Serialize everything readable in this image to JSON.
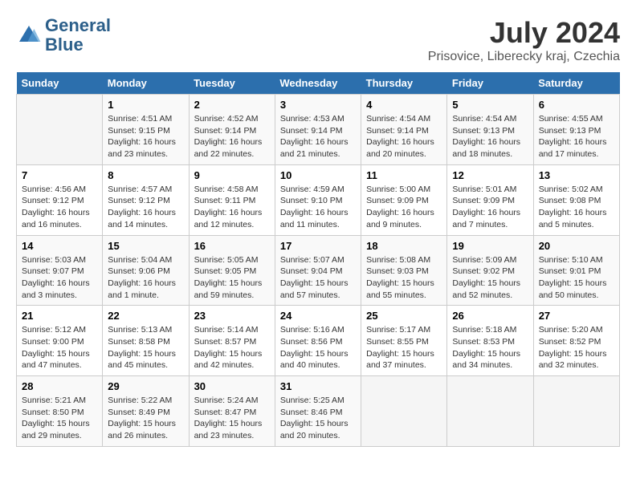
{
  "header": {
    "logo_line1": "General",
    "logo_line2": "Blue",
    "title": "July 2024",
    "subtitle": "Prisovice, Liberecky kraj, Czechia"
  },
  "calendar": {
    "headers": [
      "Sunday",
      "Monday",
      "Tuesday",
      "Wednesday",
      "Thursday",
      "Friday",
      "Saturday"
    ],
    "weeks": [
      [
        {
          "day": "",
          "info": ""
        },
        {
          "day": "1",
          "info": "Sunrise: 4:51 AM\nSunset: 9:15 PM\nDaylight: 16 hours\nand 23 minutes."
        },
        {
          "day": "2",
          "info": "Sunrise: 4:52 AM\nSunset: 9:14 PM\nDaylight: 16 hours\nand 22 minutes."
        },
        {
          "day": "3",
          "info": "Sunrise: 4:53 AM\nSunset: 9:14 PM\nDaylight: 16 hours\nand 21 minutes."
        },
        {
          "day": "4",
          "info": "Sunrise: 4:54 AM\nSunset: 9:14 PM\nDaylight: 16 hours\nand 20 minutes."
        },
        {
          "day": "5",
          "info": "Sunrise: 4:54 AM\nSunset: 9:13 PM\nDaylight: 16 hours\nand 18 minutes."
        },
        {
          "day": "6",
          "info": "Sunrise: 4:55 AM\nSunset: 9:13 PM\nDaylight: 16 hours\nand 17 minutes."
        }
      ],
      [
        {
          "day": "7",
          "info": "Sunrise: 4:56 AM\nSunset: 9:12 PM\nDaylight: 16 hours\nand 16 minutes."
        },
        {
          "day": "8",
          "info": "Sunrise: 4:57 AM\nSunset: 9:12 PM\nDaylight: 16 hours\nand 14 minutes."
        },
        {
          "day": "9",
          "info": "Sunrise: 4:58 AM\nSunset: 9:11 PM\nDaylight: 16 hours\nand 12 minutes."
        },
        {
          "day": "10",
          "info": "Sunrise: 4:59 AM\nSunset: 9:10 PM\nDaylight: 16 hours\nand 11 minutes."
        },
        {
          "day": "11",
          "info": "Sunrise: 5:00 AM\nSunset: 9:09 PM\nDaylight: 16 hours\nand 9 minutes."
        },
        {
          "day": "12",
          "info": "Sunrise: 5:01 AM\nSunset: 9:09 PM\nDaylight: 16 hours\nand 7 minutes."
        },
        {
          "day": "13",
          "info": "Sunrise: 5:02 AM\nSunset: 9:08 PM\nDaylight: 16 hours\nand 5 minutes."
        }
      ],
      [
        {
          "day": "14",
          "info": "Sunrise: 5:03 AM\nSunset: 9:07 PM\nDaylight: 16 hours\nand 3 minutes."
        },
        {
          "day": "15",
          "info": "Sunrise: 5:04 AM\nSunset: 9:06 PM\nDaylight: 16 hours\nand 1 minute."
        },
        {
          "day": "16",
          "info": "Sunrise: 5:05 AM\nSunset: 9:05 PM\nDaylight: 15 hours\nand 59 minutes."
        },
        {
          "day": "17",
          "info": "Sunrise: 5:07 AM\nSunset: 9:04 PM\nDaylight: 15 hours\nand 57 minutes."
        },
        {
          "day": "18",
          "info": "Sunrise: 5:08 AM\nSunset: 9:03 PM\nDaylight: 15 hours\nand 55 minutes."
        },
        {
          "day": "19",
          "info": "Sunrise: 5:09 AM\nSunset: 9:02 PM\nDaylight: 15 hours\nand 52 minutes."
        },
        {
          "day": "20",
          "info": "Sunrise: 5:10 AM\nSunset: 9:01 PM\nDaylight: 15 hours\nand 50 minutes."
        }
      ],
      [
        {
          "day": "21",
          "info": "Sunrise: 5:12 AM\nSunset: 9:00 PM\nDaylight: 15 hours\nand 47 minutes."
        },
        {
          "day": "22",
          "info": "Sunrise: 5:13 AM\nSunset: 8:58 PM\nDaylight: 15 hours\nand 45 minutes."
        },
        {
          "day": "23",
          "info": "Sunrise: 5:14 AM\nSunset: 8:57 PM\nDaylight: 15 hours\nand 42 minutes."
        },
        {
          "day": "24",
          "info": "Sunrise: 5:16 AM\nSunset: 8:56 PM\nDaylight: 15 hours\nand 40 minutes."
        },
        {
          "day": "25",
          "info": "Sunrise: 5:17 AM\nSunset: 8:55 PM\nDaylight: 15 hours\nand 37 minutes."
        },
        {
          "day": "26",
          "info": "Sunrise: 5:18 AM\nSunset: 8:53 PM\nDaylight: 15 hours\nand 34 minutes."
        },
        {
          "day": "27",
          "info": "Sunrise: 5:20 AM\nSunset: 8:52 PM\nDaylight: 15 hours\nand 32 minutes."
        }
      ],
      [
        {
          "day": "28",
          "info": "Sunrise: 5:21 AM\nSunset: 8:50 PM\nDaylight: 15 hours\nand 29 minutes."
        },
        {
          "day": "29",
          "info": "Sunrise: 5:22 AM\nSunset: 8:49 PM\nDaylight: 15 hours\nand 26 minutes."
        },
        {
          "day": "30",
          "info": "Sunrise: 5:24 AM\nSunset: 8:47 PM\nDaylight: 15 hours\nand 23 minutes."
        },
        {
          "day": "31",
          "info": "Sunrise: 5:25 AM\nSunset: 8:46 PM\nDaylight: 15 hours\nand 20 minutes."
        },
        {
          "day": "",
          "info": ""
        },
        {
          "day": "",
          "info": ""
        },
        {
          "day": "",
          "info": ""
        }
      ]
    ]
  }
}
